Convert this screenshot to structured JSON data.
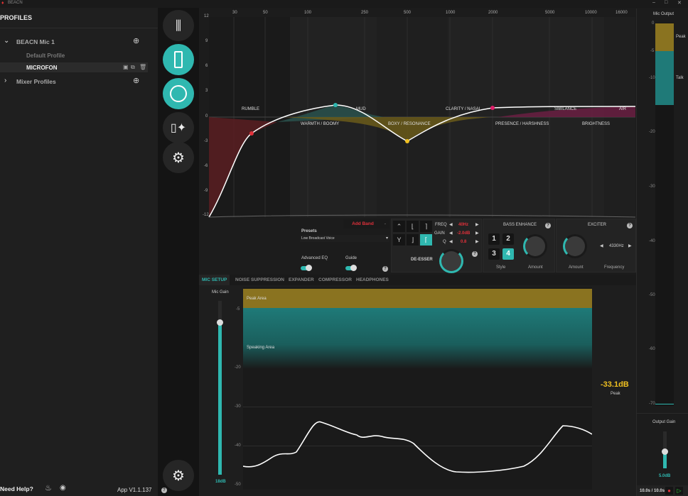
{
  "app": {
    "title": "BEACN",
    "version": "App V1.1.137",
    "need_help": "Need Help?"
  },
  "sidebar": {
    "heading": "PROFILES",
    "groups": [
      {
        "label": "BEACN Mic 1",
        "items": [
          "Default Profile",
          "MICROFON"
        ]
      },
      {
        "label": "Mixer Profiles"
      }
    ]
  },
  "nav": [
    "mixer-icon",
    "mic-icon",
    "voice-icon",
    "lighting-icon",
    "settings-icon"
  ],
  "eq": {
    "freq_labels": [
      "30",
      "50",
      "100",
      "250",
      "500",
      "1000",
      "2000",
      "5000",
      "10000",
      "16000"
    ],
    "gain_labels": [
      "12",
      "9",
      "6",
      "3",
      "0",
      "-3",
      "-6",
      "-9",
      "-12"
    ],
    "regions": [
      "RUMBLE",
      "WARMTH / BOOMY",
      "MUD",
      "BOXY / RESONANCE",
      "CLARITY / NASAL",
      "PRESENCE / HARSHNESS",
      "SIBILANCE",
      "BRIGHTNESS",
      "AIR"
    ]
  },
  "controls": {
    "add_band": "Add Band",
    "presets_label": "Presets",
    "preset_value": "Low Broadcast Voice",
    "advanced_eq": "Advanced EQ",
    "guide": "Guide",
    "freq_label": "FREQ",
    "freq": "40Hz",
    "gain_label": "GAIN",
    "gain": "-2.0dB",
    "q_label": "Q",
    "q": "0.8",
    "deesser": "DE-ESSER",
    "bass": {
      "title": "BASS ENHANCE",
      "styles": [
        "1",
        "2",
        "3",
        "4"
      ],
      "selected_style": "4",
      "style_label": "Style",
      "amount_label": "Amount"
    },
    "exciter": {
      "title": "EXCITER",
      "amount_label": "Amount",
      "frequency": "4330Hz",
      "frequency_label": "Frequency"
    }
  },
  "tabs": [
    "MIC SETUP",
    "NOISE SUPPRESSION",
    "EXPANDER",
    "COMPRESSOR",
    "HEADPHONES"
  ],
  "active_tab": "MIC SETUP",
  "mic_setup": {
    "mic_gain_label": "Mic Gain",
    "mic_gain": "18dB",
    "peak_area": "Peak Area",
    "speaking_area": "Speaking Area",
    "level_labels": [
      "-5",
      "-20",
      "-30",
      "-40",
      "-50"
    ],
    "peak_value": "-33.1dB",
    "peak_label": "Peak"
  },
  "mic_output": {
    "title": "Mic Output",
    "labels": [
      "0",
      "-5",
      "-10",
      "-20",
      "-30",
      "-40",
      "-50",
      "-60",
      "-70"
    ],
    "peak": "Peak",
    "talk": "Talk",
    "output_gain_label": "Output Gain",
    "output_gain": "5.0dB",
    "time": "10.0s / 10.0s"
  },
  "colors": {
    "accent": "#2fb8b0",
    "peak": "#8a7320",
    "red": "#e0303a",
    "yellow": "#f0c020"
  }
}
